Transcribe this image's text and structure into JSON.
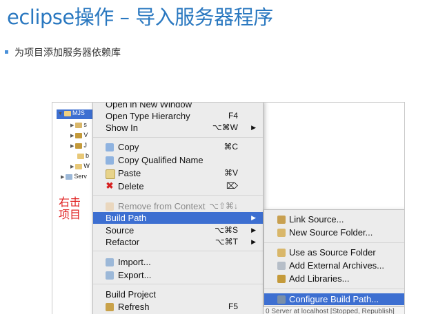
{
  "slide": {
    "title": "eclipse操作 – 导入服务器程序",
    "bullet": "为项目添加服务器依赖库"
  },
  "tree": {
    "items": [
      {
        "label": "MJS"
      },
      {
        "label": "s"
      },
      {
        "label": "V"
      },
      {
        "label": "J"
      },
      {
        "label": "b"
      },
      {
        "label": "W"
      },
      {
        "label": "Serv"
      }
    ]
  },
  "annotation": {
    "line1": "右击",
    "line2": "项目"
  },
  "context_menu": {
    "items": [
      {
        "label": "Open in New Window",
        "shortcut": ""
      },
      {
        "label": "Open Type Hierarchy",
        "shortcut": "F4"
      },
      {
        "label": "Show In",
        "shortcut": "⌥⌘W",
        "arrow": "▶"
      },
      {
        "label": "Copy",
        "shortcut": "⌘C"
      },
      {
        "label": "Copy Qualified Name",
        "shortcut": ""
      },
      {
        "label": "Paste",
        "shortcut": "⌘V"
      },
      {
        "label": "Delete",
        "shortcut": "⌦"
      },
      {
        "label": "Remove from Context",
        "shortcut": "⌥⇧⌘↓"
      },
      {
        "label": "Build Path",
        "shortcut": "",
        "arrow": "▶"
      },
      {
        "label": "Source",
        "shortcut": "⌥⌘S",
        "arrow": "▶"
      },
      {
        "label": "Refactor",
        "shortcut": "⌥⌘T",
        "arrow": "▶"
      },
      {
        "label": "Import...",
        "shortcut": ""
      },
      {
        "label": "Export...",
        "shortcut": ""
      },
      {
        "label": "Build Project",
        "shortcut": ""
      },
      {
        "label": "Refresh",
        "shortcut": "F5"
      }
    ]
  },
  "submenu": {
    "items": [
      {
        "label": "Link Source..."
      },
      {
        "label": "New Source Folder..."
      },
      {
        "label": "Use as Source Folder"
      },
      {
        "label": "Add External Archives..."
      },
      {
        "label": "Add Libraries..."
      },
      {
        "label": "Configure Build Path..."
      }
    ]
  },
  "status": {
    "text": "0 Server at localhost  [Stopped, Republish]"
  },
  "colors": {
    "title": "#2a78c0",
    "highlight": "#3d6fd1",
    "annotation": "#e02020"
  }
}
